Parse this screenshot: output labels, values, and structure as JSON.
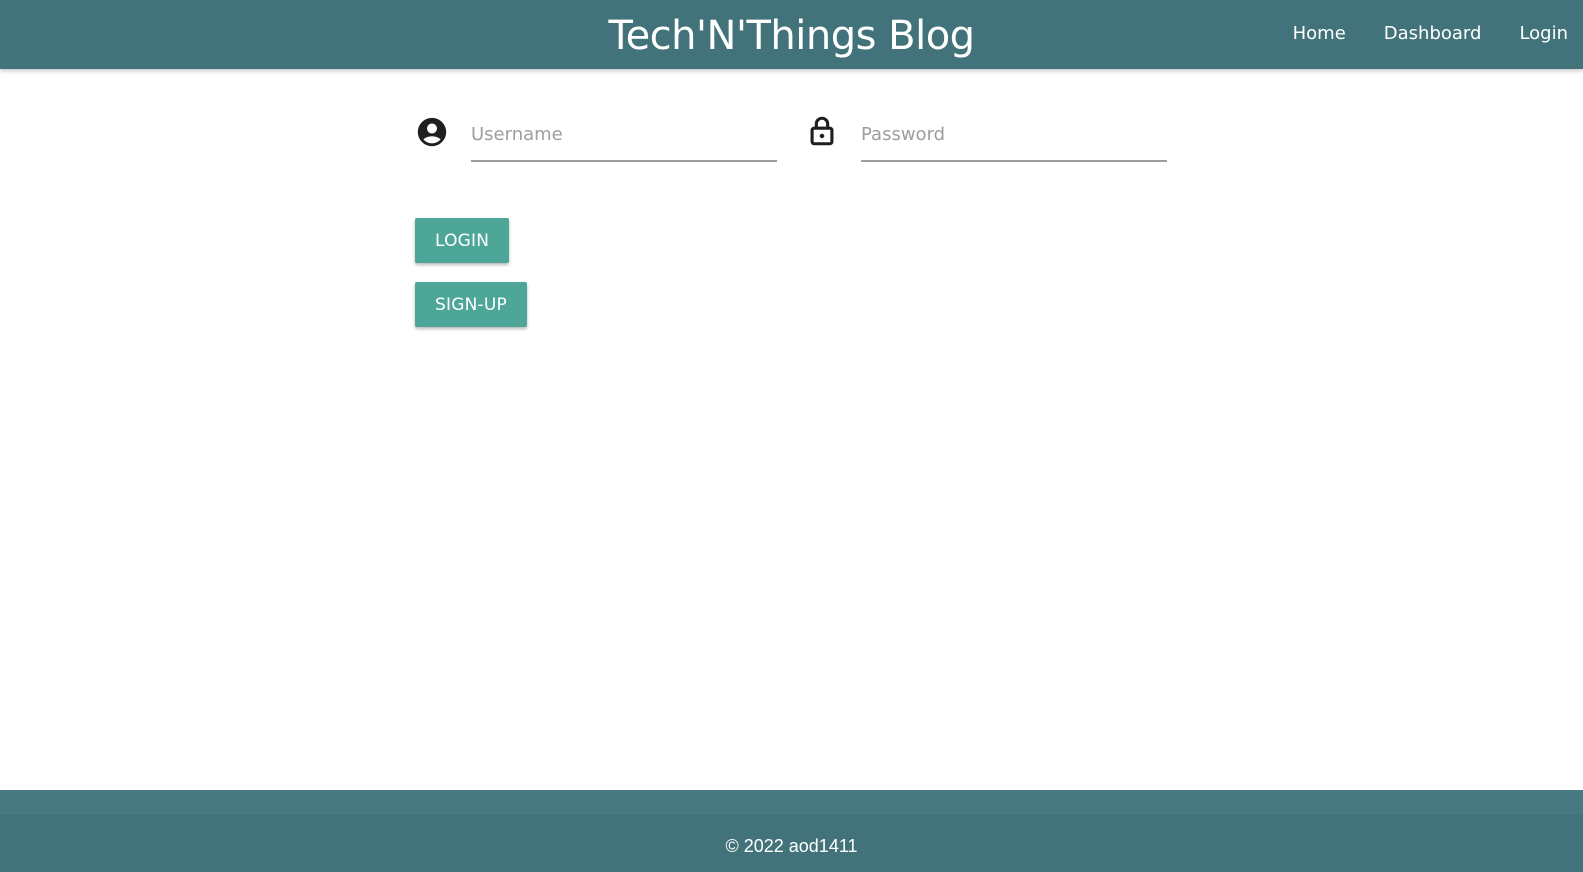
{
  "header": {
    "title": "Tech'N'Things Blog",
    "nav": [
      {
        "label": "Home"
      },
      {
        "label": "Dashboard"
      },
      {
        "label": "Login"
      }
    ]
  },
  "form": {
    "username": {
      "placeholder": "Username",
      "value": "",
      "icon": "account-circle-icon"
    },
    "password": {
      "placeholder": "Password",
      "value": "",
      "icon": "lock-icon"
    }
  },
  "buttons": {
    "login": "LOGIN",
    "signup": "SIGN-UP"
  },
  "footer": {
    "text": "© 2022 aod1411"
  },
  "colors": {
    "header_bg": "#42737a",
    "button_bg": "#4ea699",
    "footer_bg": "#42737a"
  }
}
